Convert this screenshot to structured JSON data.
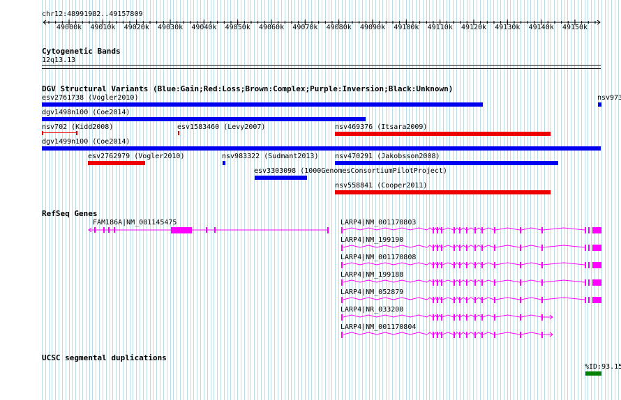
{
  "ruler": {
    "coords": "chr12:48991982..49157809",
    "ticks": [
      "49000k",
      "49010k",
      "49020k",
      "49030k",
      "49040k",
      "49050k",
      "49060k",
      "49070k",
      "49080k",
      "49090k",
      "49100k",
      "49110k",
      "49120k",
      "49130k",
      "49140k",
      "49150k"
    ]
  },
  "cyto": {
    "title": "Cytogenetic Bands",
    "band": "12q13.13"
  },
  "dgv": {
    "title": "DGV Structural Variants (Blue:Gain;Red:Loss;Brown:Complex;Purple:Inversion;Black:Unknown)",
    "colors": {
      "gain": "#0000ee",
      "loss": "#ee0000"
    },
    "features": [
      {
        "label": "esv2761738 (Vogler2010)",
        "type": "gain"
      },
      {
        "label": "nsv973",
        "type": "gain"
      },
      {
        "label": "dgv1498n100 (Coe2014)",
        "type": "gain"
      },
      {
        "label": "nsv702 (Kidd2008)",
        "type": "loss"
      },
      {
        "label": "esv1583460 (Levy2007)",
        "type": "loss"
      },
      {
        "label": "nsv469376 (Itsara2009)",
        "type": "loss"
      },
      {
        "label": "dgv1499n100 (Coe2014)",
        "type": "gain"
      },
      {
        "label": "esv2762979 (Vogler2010)",
        "type": "loss"
      },
      {
        "label": "nsv983322 (Sudmant2013)",
        "type": "gain"
      },
      {
        "label": "nsv470291 (Jakobsson2008)",
        "type": "gain"
      },
      {
        "label": "esv3303098 (1000GenomesConsortiumPilotProject)",
        "type": "gain"
      },
      {
        "label": "nsv558841 (Cooper2011)",
        "type": "loss"
      }
    ]
  },
  "refseq": {
    "title": "RefSeq Genes",
    "color": "#ff00ff",
    "genes": [
      "FAM186A|NM_001145475",
      "LARP4|NM_001170803",
      "LARP4|NM_199190",
      "LARP4|NM_001170808",
      "LARP4|NM_199188",
      "LARP4|NM_052879",
      "LARP4|NR_033200",
      "LARP4|NM_001170804"
    ]
  },
  "segdup": {
    "title": "UCSC segmental duplications",
    "label": "%ID:93.15",
    "color": "#008000"
  }
}
